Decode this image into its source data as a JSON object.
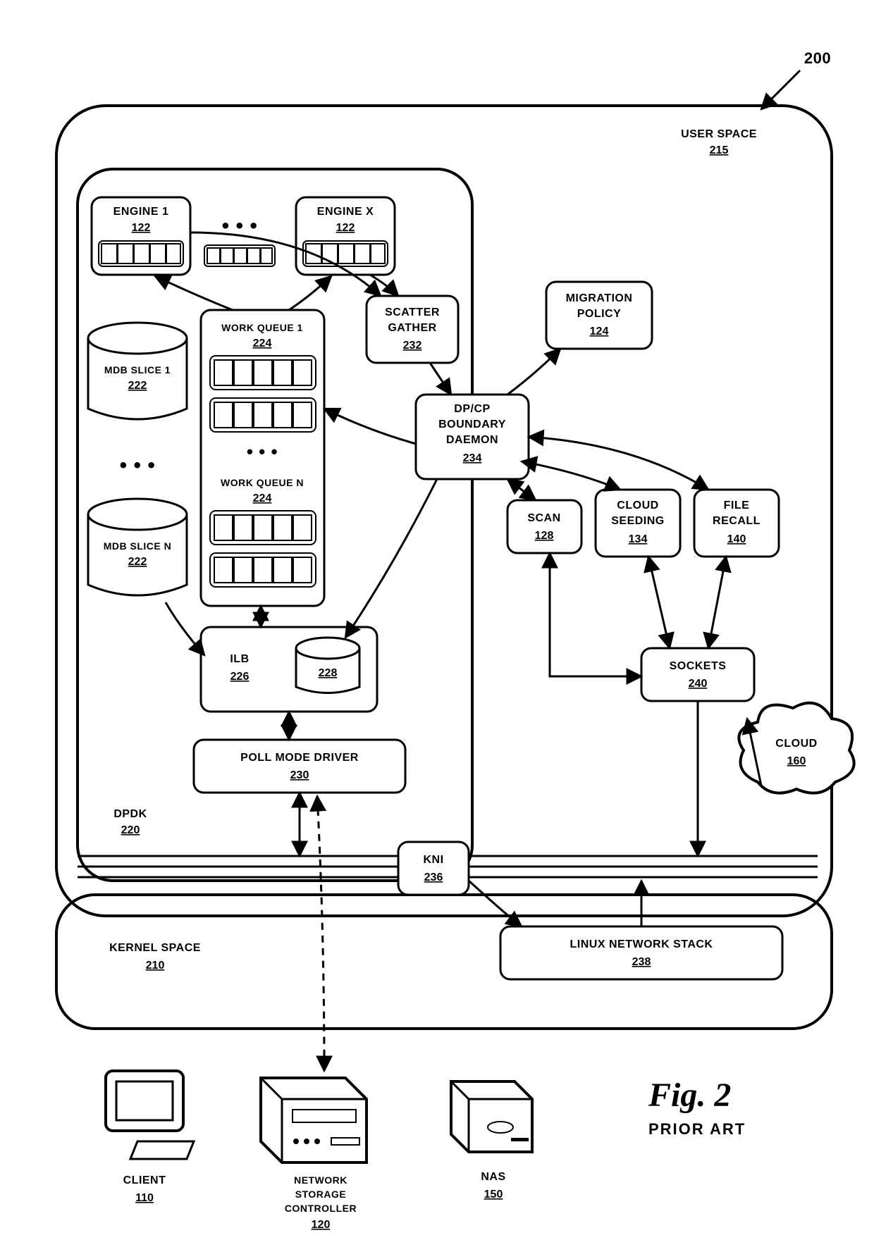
{
  "figure": {
    "label": "Fig. 2",
    "subtitle": "PRIOR ART",
    "ref": "200"
  },
  "user_space": {
    "label": "USER SPACE",
    "ref": "215"
  },
  "kernel_space": {
    "label": "KERNEL SPACE",
    "ref": "210"
  },
  "dpdk": {
    "label": "DPDK",
    "ref": "220"
  },
  "engines": {
    "one": {
      "label": "ENGINE 1",
      "ref": "122"
    },
    "x": {
      "label": "ENGINE X",
      "ref": "122"
    }
  },
  "mdb": {
    "one": {
      "label": "MDB SLICE 1",
      "ref": "222"
    },
    "n": {
      "label": "MDB SLICE N",
      "ref": "222"
    }
  },
  "wq": {
    "one": {
      "label": "WORK QUEUE 1",
      "ref": "224"
    },
    "n": {
      "label": "WORK QUEUE N",
      "ref": "224"
    }
  },
  "ilb": {
    "label": "ILB",
    "ref": "226",
    "disk_ref": "228"
  },
  "pmd": {
    "label": "POLL MODE DRIVER",
    "ref": "230"
  },
  "scatter": {
    "label1": "SCATTER",
    "label2": "GATHER",
    "ref": "232"
  },
  "daemon": {
    "label1": "DP/CP",
    "label2": "BOUNDARY",
    "label3": "DAEMON",
    "ref": "234"
  },
  "migration": {
    "label1": "MIGRATION",
    "label2": "POLICY",
    "ref": "124"
  },
  "scan": {
    "label": "SCAN",
    "ref": "128"
  },
  "seed": {
    "label1": "CLOUD",
    "label2": "SEEDING",
    "ref": "134"
  },
  "recall": {
    "label1": "FILE",
    "label2": "RECALL",
    "ref": "140"
  },
  "sockets": {
    "label": "SOCKETS",
    "ref": "240"
  },
  "kni": {
    "label": "KNI",
    "ref": "236"
  },
  "lns": {
    "label": "LINUX NETWORK STACK",
    "ref": "238"
  },
  "client": {
    "label": "CLIENT",
    "ref": "110"
  },
  "nsc": {
    "label1": "NETWORK",
    "label2": "STORAGE",
    "label3": "CONTROLLER",
    "ref": "120"
  },
  "nas": {
    "label": "NAS",
    "ref": "150"
  },
  "cloud": {
    "label": "CLOUD",
    "ref": "160"
  },
  "dots": "• • •"
}
